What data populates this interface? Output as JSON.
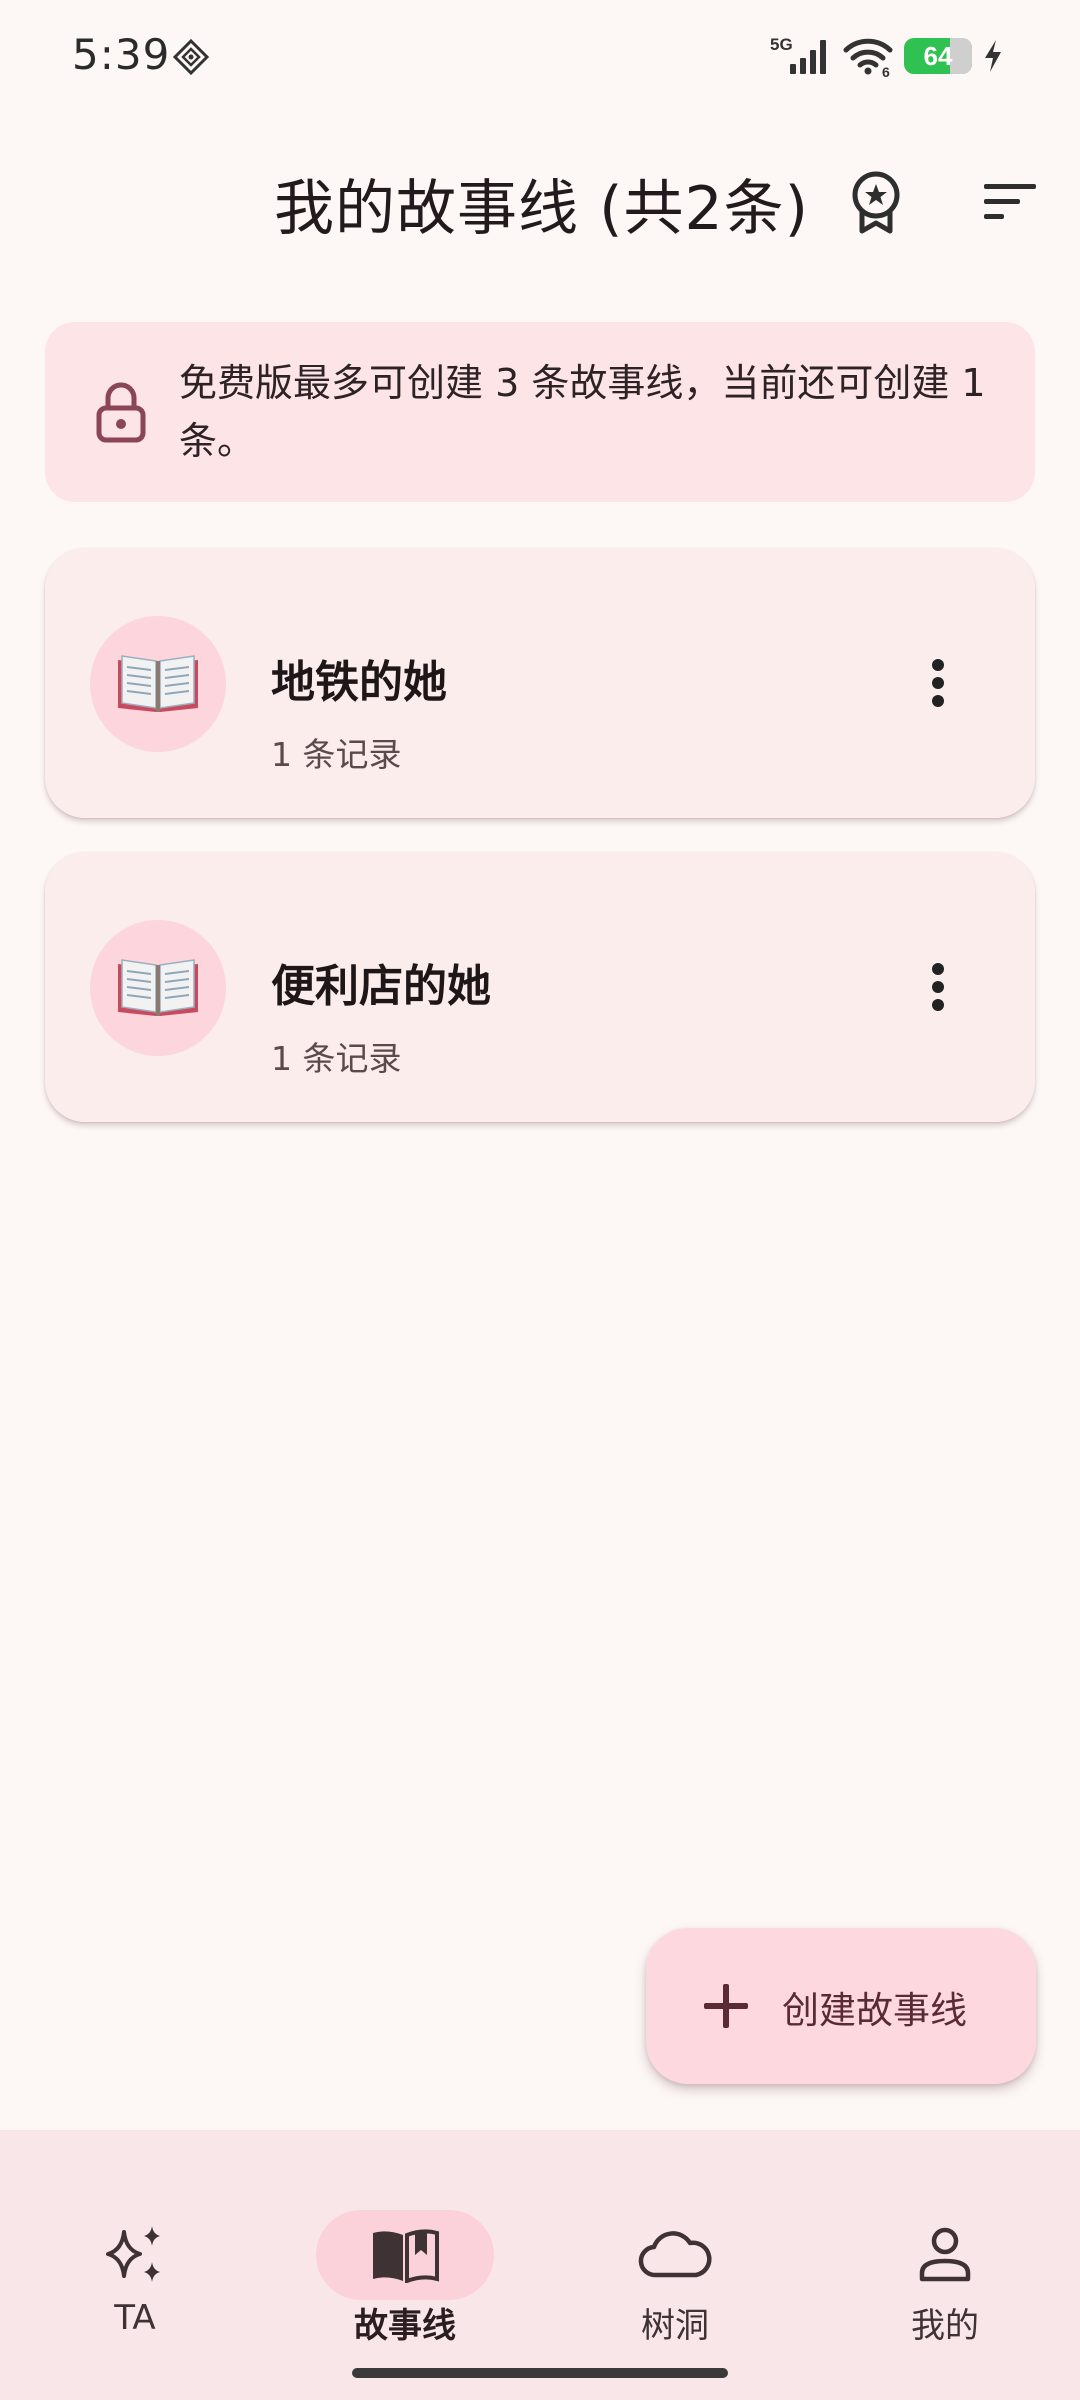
{
  "status_bar": {
    "time": "5:39",
    "network_label": "5G",
    "wifi_badge": "6",
    "battery_level": "64",
    "icons": [
      "app-badge-icon",
      "signal-icon",
      "wifi-icon",
      "battery-icon",
      "charging-icon"
    ]
  },
  "header": {
    "title": "我的故事线 (共2条)",
    "icons": [
      "award-icon",
      "sort-icon"
    ]
  },
  "notice": {
    "text": "免费版最多可创建 3 条故事线，当前还可创建 1 条。",
    "icon": "lock-icon"
  },
  "stories": [
    {
      "name": "地铁的她",
      "count": "1 条记录",
      "icon": "open-book-icon"
    },
    {
      "name": "便利店的她",
      "count": "1 条记录",
      "icon": "open-book-icon"
    }
  ],
  "fab": {
    "label": "创建故事线",
    "icon": "plus-icon"
  },
  "bottom_nav": [
    {
      "label": "TA",
      "icon": "sparkles-icon",
      "active": false
    },
    {
      "label": "故事线",
      "icon": "book-icon",
      "active": true
    },
    {
      "label": "树洞",
      "icon": "cloud-icon",
      "active": false
    },
    {
      "label": "我的",
      "icon": "person-icon",
      "active": false
    }
  ],
  "colors": {
    "background": "#FDF8F6",
    "notice_bg": "#FCE4E7",
    "card_bg": "#FAEDEC",
    "accent_pink": "#FDD5DC",
    "lock_color": "#8A4556",
    "battery_green": "#2FC152"
  }
}
